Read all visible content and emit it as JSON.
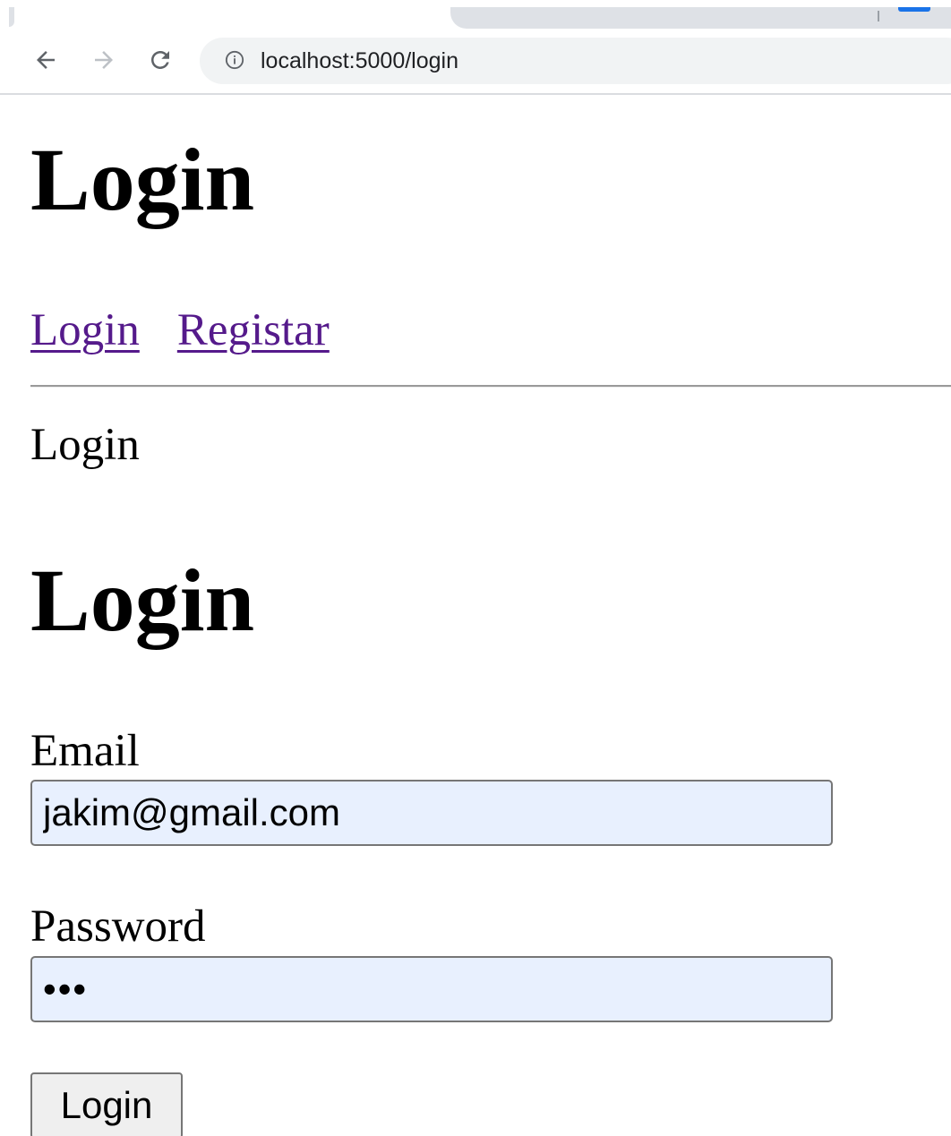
{
  "browser": {
    "url": "localhost:5000/login",
    "icons": {
      "back": "arrow-left-icon",
      "forward": "arrow-right-icon",
      "reload": "reload-icon",
      "site_info": "info-icon"
    },
    "colors": {
      "chrome_tab": "#dee1e6",
      "omnibox": "#f1f3f4",
      "accent": "#1a73e8"
    }
  },
  "page": {
    "heading": "Login",
    "nav": {
      "login_link": "Login",
      "register_link": "Registar"
    },
    "section_label": "Login",
    "form": {
      "heading": "Login",
      "email_label": "Email",
      "email_value": "jakim@gmail.com",
      "password_label": "Password",
      "password_display": "•••",
      "submit_label": "Login"
    },
    "colors": {
      "visited_link": "#551a8b",
      "autofill_bg": "#e8f0fe",
      "button_bg": "#efefef"
    }
  }
}
